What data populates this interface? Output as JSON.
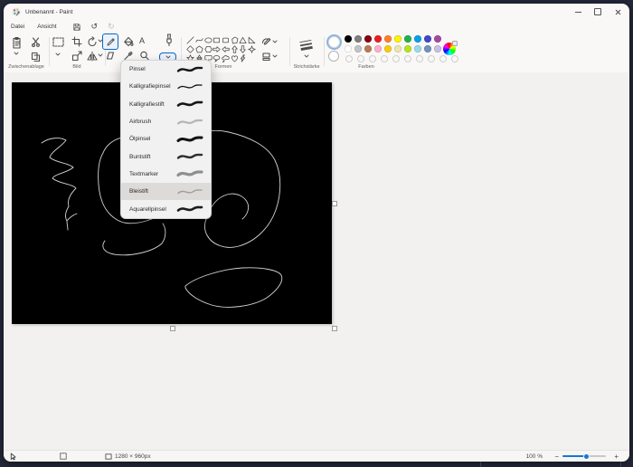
{
  "window": {
    "title": "Unbenannt - Paint"
  },
  "menubar": {
    "items": [
      "Datei",
      "Ansicht"
    ]
  },
  "sections": {
    "clipboard": "Zwischenablage",
    "image": "Bild",
    "shapes": "Formen",
    "stroke_width": "Strichstärke",
    "colors": "Farben"
  },
  "tools": {
    "text_tool_label": "A"
  },
  "brush_menu": {
    "items": [
      {
        "label": "Pinsel",
        "stroke_color": "#161616",
        "stroke_width": 2.4,
        "highlighted": false
      },
      {
        "label": "Kalligrafiepinsel",
        "stroke_color": "#161616",
        "stroke_width": 1.3,
        "highlighted": false
      },
      {
        "label": "Kalligrafiestift",
        "stroke_color": "#161616",
        "stroke_width": 2.6,
        "highlighted": false
      },
      {
        "label": "Airbrush",
        "stroke_color": "#b5b5b5",
        "stroke_width": 2.2,
        "highlighted": false
      },
      {
        "label": "Ölpinsel",
        "stroke_color": "#111111",
        "stroke_width": 3.0,
        "highlighted": false
      },
      {
        "label": "Buntstift",
        "stroke_color": "#2e2e2e",
        "stroke_width": 2.4,
        "highlighted": false
      },
      {
        "label": "Textmarker",
        "stroke_color": "#8f8f8f",
        "stroke_width": 3.2,
        "highlighted": false
      },
      {
        "label": "Bleistift",
        "stroke_color": "#9e9e9e",
        "stroke_width": 1.4,
        "highlighted": true
      },
      {
        "label": "Aquarellpinsel",
        "stroke_color": "#1d1d1d",
        "stroke_width": 2.6,
        "highlighted": false
      }
    ]
  },
  "palette": {
    "color1": "#ffffff",
    "color2": "#ffffff",
    "row1": [
      "#000000",
      "#7f7f7f",
      "#870014",
      "#ec1c23",
      "#ff7e26",
      "#fef200",
      "#21b14b",
      "#00a1e7",
      "#3e48cc",
      "#a349a4"
    ],
    "row2": [
      "#ffffff",
      "#c3c3c3",
      "#b97a56",
      "#ffaec8",
      "#ffc90d",
      "#efe4af",
      "#b5e61c",
      "#99d9ea",
      "#7092be",
      "#c8bfe7"
    ],
    "empty_count": 10
  },
  "shapes_grid": {
    "names": [
      "line",
      "curve",
      "ellipse",
      "rectangle",
      "rounded-rectangle",
      "polygon",
      "triangle",
      "right-triangle",
      "diamond",
      "pentagon",
      "hexagon",
      "arrow-right",
      "arrow-left",
      "arrow-up",
      "arrow-down",
      "four-point-star",
      "five-point-star",
      "six-point-star",
      "rounded-callout",
      "oval-callout",
      "cloud-callout",
      "heart",
      "lightning"
    ]
  },
  "canvas": {
    "background": "#000000",
    "stroke_color": "#d4d4d4",
    "strokes": [
      "M33,67 C41,61 53,60 60,64 C55,71 44,76 42,83 C49,89 63,89 68,94 C61,100 48,101 45,106 C52,112 67,112 71,117 C65,123 61,130 63,137 C60,142 58,148 61,153 C64,149 69,146 72,145 M61,153 C61,157 62,160 62,163",
      "M122,61 C112,63 104,70 101,78 C93,91 95,119 100,132 C104,143 113,152 124,155 C139,158 160,151 169,142",
      "M103,175 C98,182 102,188 113,190 C132,193 156,187 166,178 C171,171 171,162 167,156",
      "M204,58 C214,53 227,52 240,55 C262,60 283,70 291,86 C299,102 298,124 292,141 C285,161 269,176 251,181 C237,185 222,180 216,169 C212,162 213,153 217,148",
      "M217,146 C221,135 228,127 238,124 C248,121 258,126 261,134 C263,140 260,147 255,151",
      "M192,225 C205,214 236,206 255,205 C276,204 294,207 298,213 C301,219 295,229 282,238 C266,248 238,251 221,246 C208,242 196,235 192,227 Z"
    ]
  },
  "status_bar": {
    "canvas_size": "1280 × 960px",
    "zoom_level": "100 %",
    "zoom_out_label": "−",
    "zoom_in_label": "+"
  }
}
